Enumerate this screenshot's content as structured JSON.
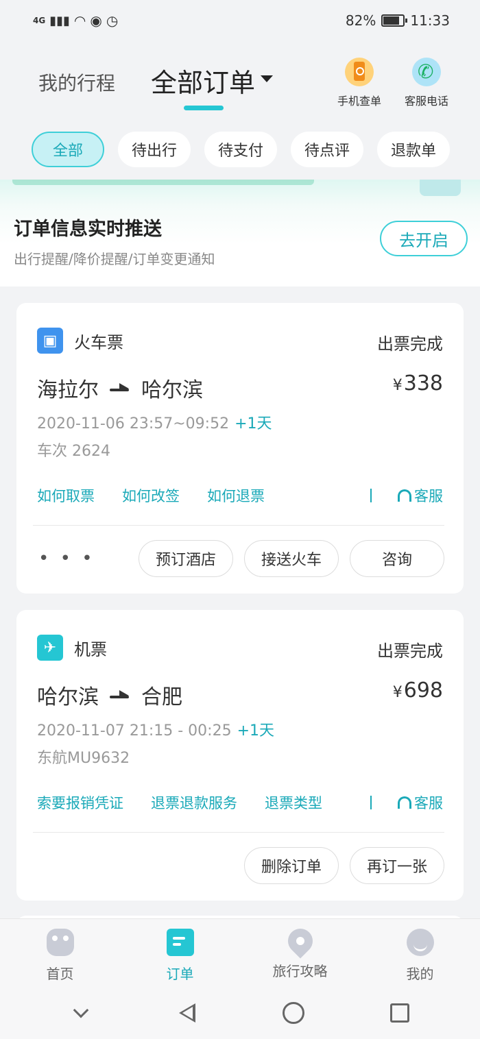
{
  "status_bar": {
    "network": "4G",
    "battery": "82%",
    "battery_level": 0.82,
    "time": "11:33"
  },
  "header": {
    "tab_trip": "我的行程",
    "tab_all_orders": "全部订单",
    "actions": [
      {
        "label": "手机查单",
        "icon": "phone-search-icon"
      },
      {
        "label": "客服电话",
        "icon": "service-phone-icon"
      }
    ]
  },
  "filters": [
    "全部",
    "待出行",
    "待支付",
    "待点评",
    "退款单"
  ],
  "notify": {
    "title": "订单信息实时推送",
    "subtitle": "出行提醒/降价提醒/订单变更通知",
    "button": "去开启"
  },
  "orders": [
    {
      "type": "火车票",
      "status": "出票完成",
      "from": "海拉尔",
      "to": "哈尔滨",
      "currency": "¥",
      "price": "338",
      "time": "2020-11-06 23:57~09:52",
      "plus_day": "+1天",
      "number": "车次 2624",
      "links": [
        "如何取票",
        "如何改签",
        "如何退票"
      ],
      "service": "客服",
      "more": "• • •",
      "buttons": [
        "预订酒店",
        "接送火车",
        "咨询"
      ]
    },
    {
      "type": "机票",
      "status": "出票完成",
      "from": "哈尔滨",
      "to": "合肥",
      "currency": "¥",
      "price": "698",
      "time": "2020-11-07 21:15 - 00:25",
      "plus_day": "+1天",
      "number": "东航MU9632",
      "links": [
        "索要报销凭证",
        "退票退款服务",
        "退票类型"
      ],
      "service": "客服",
      "buttons": [
        "删除订单",
        "再订一张"
      ]
    }
  ],
  "tabbar": [
    {
      "label": "首页",
      "icon": "home-icon"
    },
    {
      "label": "订单",
      "icon": "order-icon"
    },
    {
      "label": "旅行攻略",
      "icon": "location-icon"
    },
    {
      "label": "我的",
      "icon": "profile-icon"
    }
  ],
  "colors": {
    "accent": "#25c6d3",
    "accent_text": "#1aa9b8",
    "train_icon": "#3f93ee"
  }
}
